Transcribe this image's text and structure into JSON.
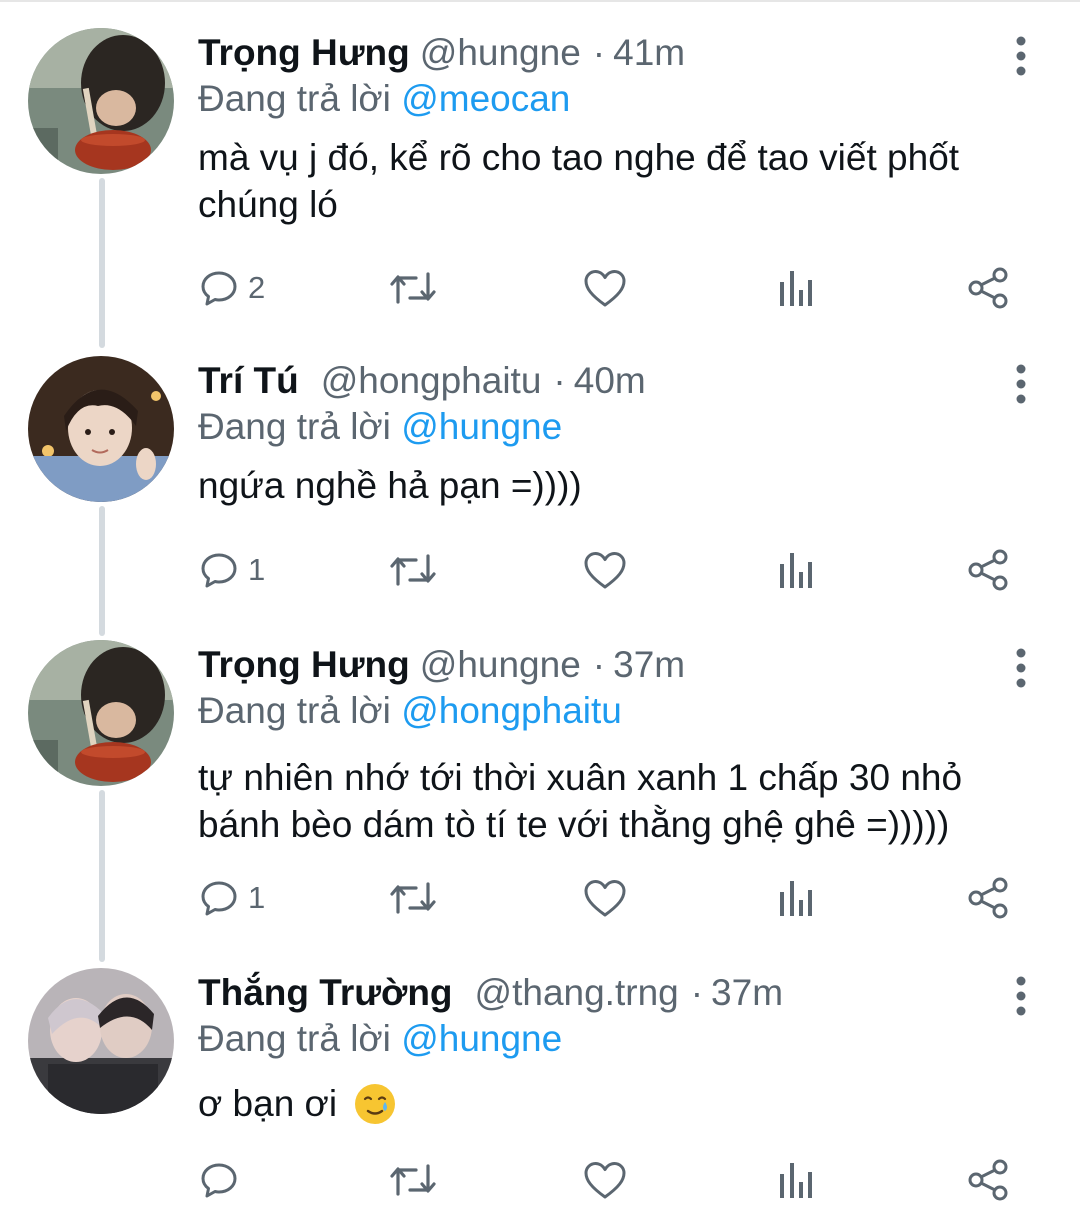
{
  "tweets": [
    {
      "name": "Trọng Hưng",
      "handle": "@hungne",
      "time": "41m",
      "replying_prefix": "Đang trả lời",
      "replying_to": "@meocan",
      "text": "mà vụ j đó, kể rõ cho tao nghe để tao viết phốt chúng ló",
      "reply_count": "2"
    },
    {
      "name": "Trí Tú",
      "handle": "@hongphaitu",
      "time": "40m",
      "replying_prefix": "Đang trả lời",
      "replying_to": "@hungne",
      "text": "ngứa nghề hả pạn =))))",
      "reply_count": "1"
    },
    {
      "name": "Trọng Hưng",
      "handle": "@hungne",
      "time": "37m",
      "replying_prefix": "Đang trả lời",
      "replying_to": "@hongphaitu",
      "text": "tự nhiên nhớ tới thời xuân xanh 1 chấp 30 nhỏ bánh bèo dám tò tí te với thằng ghệ ghê =)))))",
      "reply_count": "1"
    },
    {
      "name": "Thắng Trường",
      "handle": "@thang.trng",
      "time": "37m",
      "replying_prefix": "Đang trả lời",
      "replying_to": "@hungne",
      "text": "ơ bạn ơi",
      "reply_count": ""
    }
  ],
  "icons": {
    "reply": "reply-icon",
    "retweet": "retweet-icon",
    "like": "heart-icon",
    "analytics": "analytics-icon",
    "share": "share-icon",
    "more": "more-vertical-icon",
    "emoji": "smiling-face-with-tear-emoji"
  },
  "colors": {
    "mention": "#1d9bf0",
    "secondary_text": "#5b6670",
    "thread_line": "#d4dadf"
  }
}
